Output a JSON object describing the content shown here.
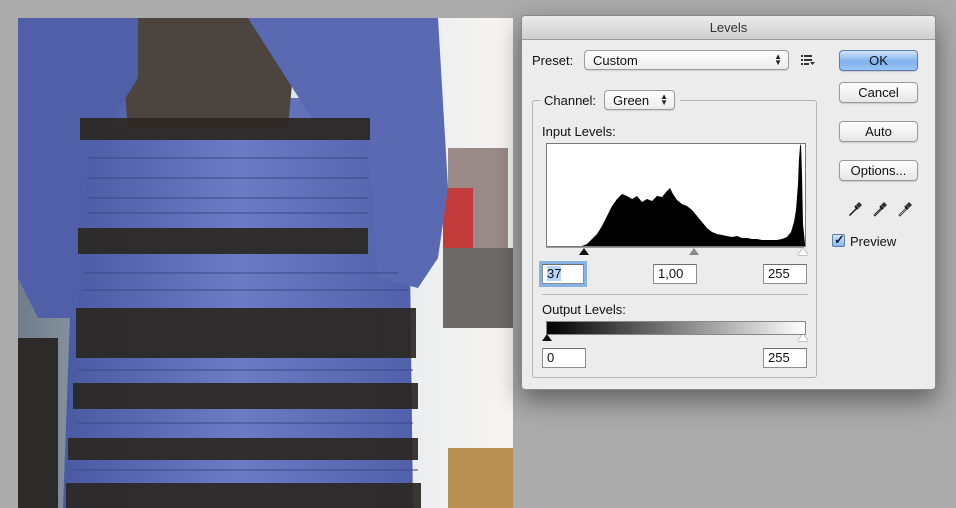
{
  "dialog": {
    "title": "Levels",
    "preset_label": "Preset:",
    "preset_value": "Custom",
    "channel_label": "Channel:",
    "channel_value": "Green",
    "input_levels_label": "Input Levels:",
    "output_levels_label": "Output Levels:",
    "input_values": {
      "black": "37",
      "gamma": "1,00",
      "white": "255"
    },
    "output_values": {
      "black": "0",
      "white": "255"
    },
    "buttons": {
      "ok": "OK",
      "cancel": "Cancel",
      "auto": "Auto",
      "options": "Options..."
    },
    "preview_label": "Preview",
    "preview_checked": true,
    "histogram_channel_color": "#000000"
  },
  "colors": {
    "ok_button": "#7fb1ee",
    "dress_blue": "#5868b0",
    "lace_black": "#2a2620"
  }
}
